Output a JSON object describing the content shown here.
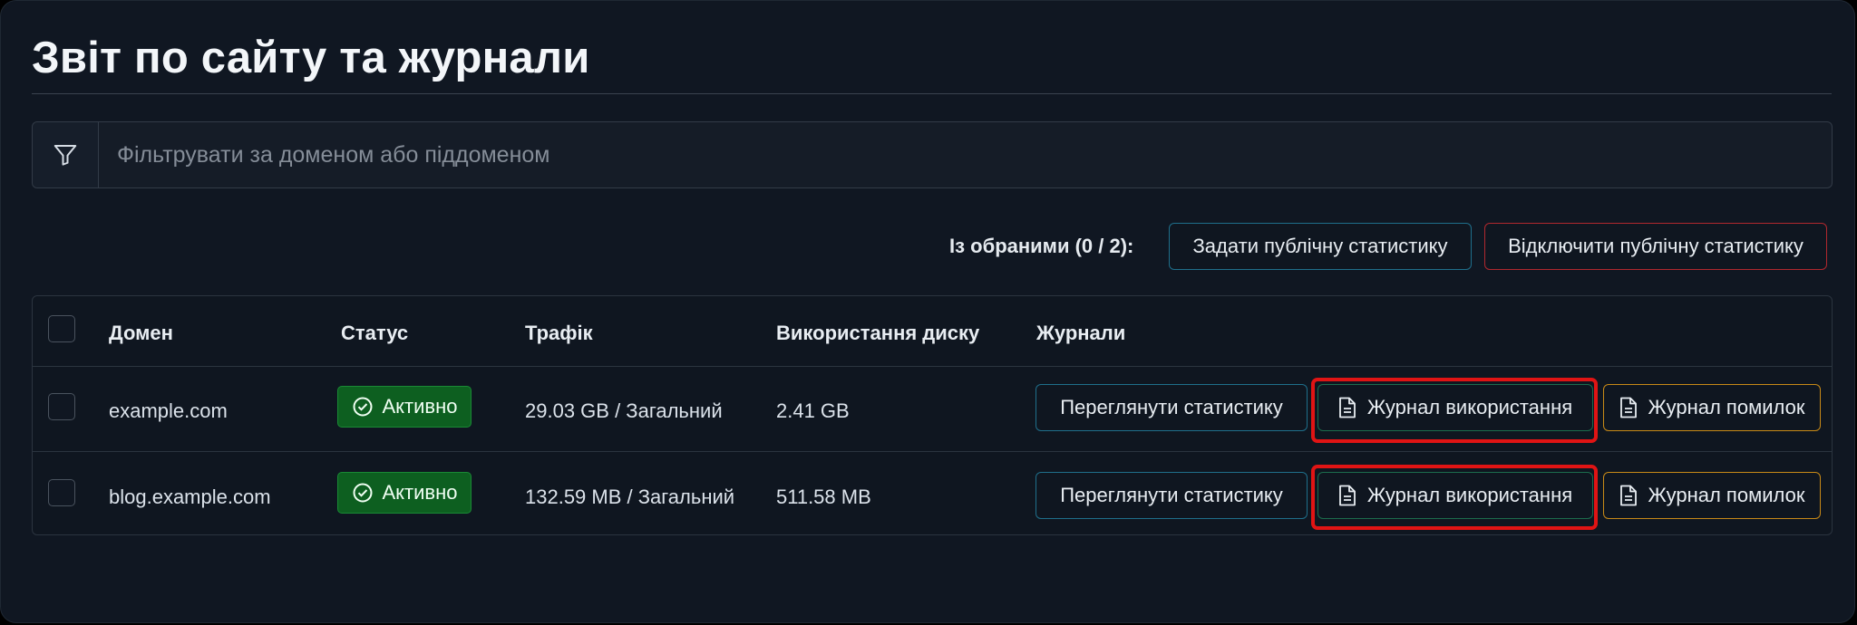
{
  "header": {
    "title": "Звіт по сайту та журнали"
  },
  "filter": {
    "icon": "filter-icon",
    "placeholder": "Фільтрувати за доменом або піддоменом",
    "value": ""
  },
  "bulk": {
    "label": "Із обраними (0 / 2):",
    "set_public_label": "Задати публічну статистику",
    "disable_public_label": "Відключити публічну статистику"
  },
  "table": {
    "columns": [
      "Домен",
      "Статус",
      "Трафік",
      "Використання диску",
      "Журнали"
    ],
    "rows": [
      {
        "domain": "example.com",
        "status": "Активно",
        "traffic": "29.03 GB / Загальний",
        "disk": "2.41 GB",
        "stats_label": "Переглянути статистику",
        "usage_label": "Журнал використання",
        "errors_label": "Журнал помилок"
      },
      {
        "domain": "blog.example.com",
        "status": "Активно",
        "traffic": "132.59 MB / Загальний",
        "disk": "511.58 MB",
        "stats_label": "Переглянути статистику",
        "usage_label": "Журнал використання",
        "errors_label": "Журнал помилок"
      }
    ]
  },
  "colors": {
    "background": "#101722",
    "accent_blue": "#1f6f8b",
    "danger_red": "#b0282e",
    "success_green": "#0d5f20",
    "warning_orange": "#c88a17",
    "highlight_red": "#e01414"
  }
}
